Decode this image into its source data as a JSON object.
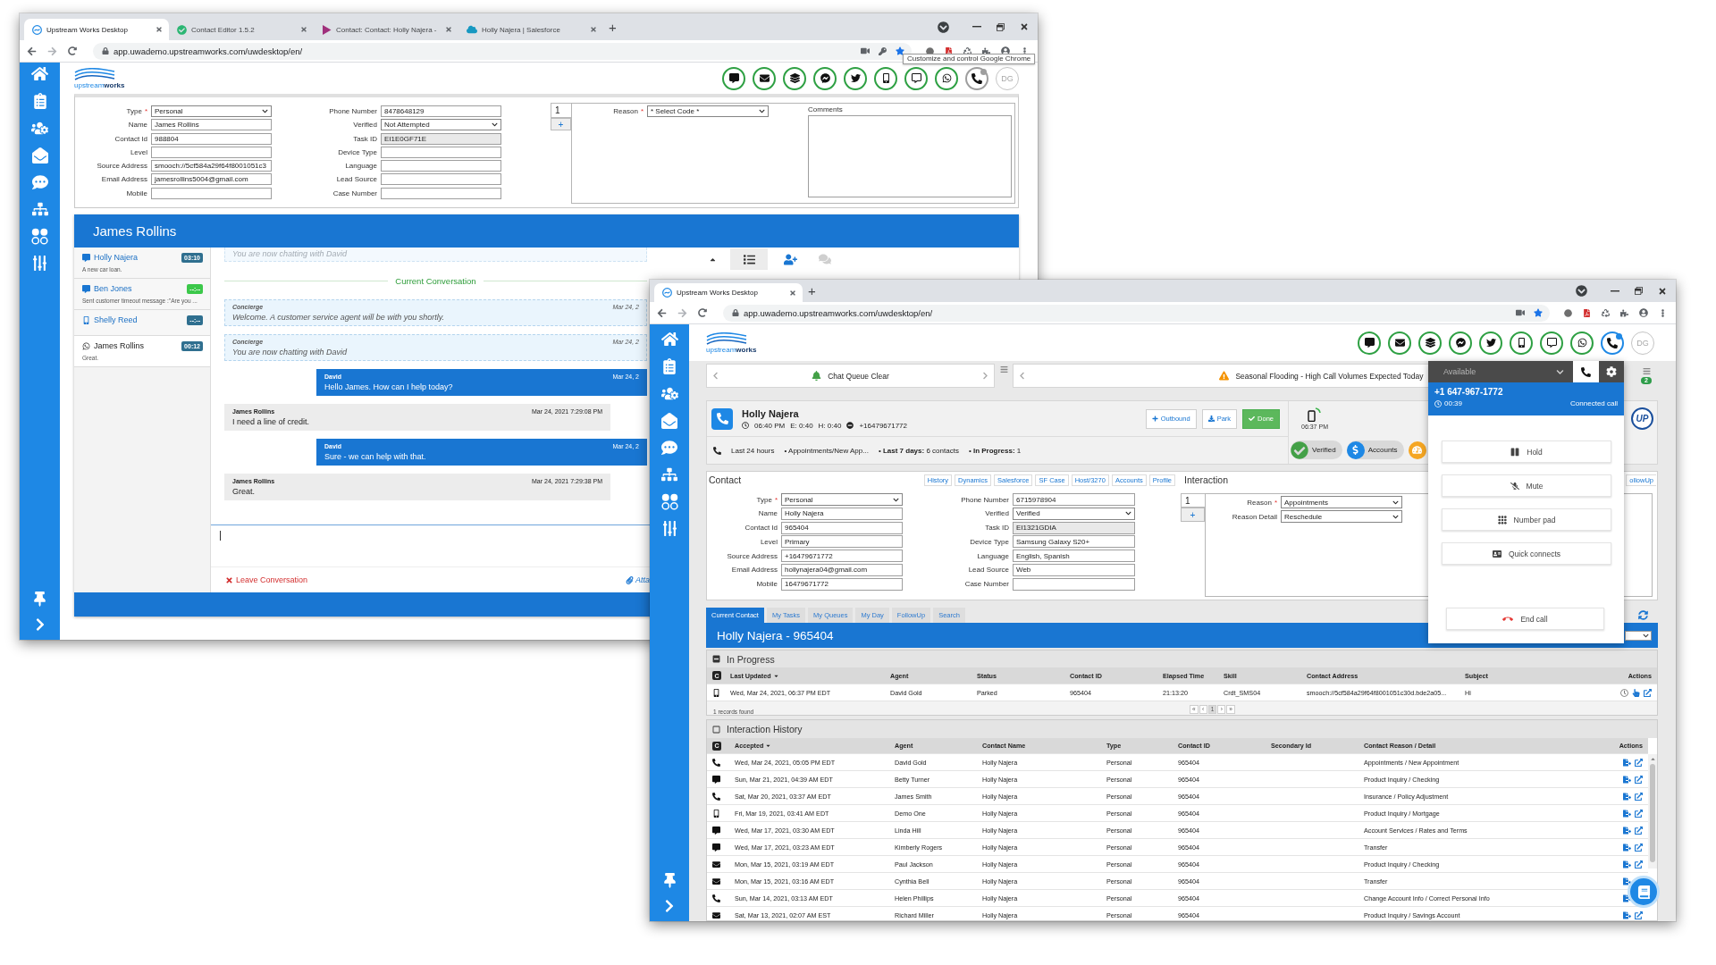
{
  "back_window": {
    "tabs": [
      {
        "title": "Upstream Works Desktop",
        "kind": "upstream",
        "selected": true
      },
      {
        "title": "Contact Editor 1.5.2",
        "kind": "editor",
        "selected": false
      },
      {
        "title": "Contact: Contact: Holly Najera -",
        "kind": "dynamics",
        "selected": false
      },
      {
        "title": "Holly Najera | Salesforce",
        "kind": "salesforce",
        "selected": false
      }
    ],
    "new_tab": "+",
    "url": "app.uwademo.upstreamworks.com/uwdesktop/en/",
    "tooltip": "Customize and control Google Chrome",
    "logo": "upstream**works**",
    "phone_channel_active": false,
    "avatar": "DG",
    "contact_left": [
      {
        "label": "Type",
        "required_mark": "*",
        "kind": "select",
        "value": "Personal",
        "disabled": false
      },
      {
        "label": "Name",
        "kind": "text",
        "value": "James Rollins",
        "disabled": false
      },
      {
        "label": "Contact Id",
        "kind": "text",
        "value": "988804",
        "disabled": false
      },
      {
        "label": "Level",
        "kind": "text",
        "disabled": false
      },
      {
        "label": "Source Address",
        "kind": "text",
        "value": "smooch://5cf584a29f64f8001051c3",
        "disabled": false
      },
      {
        "label": "Email Address",
        "kind": "text",
        "value": "jamesrollins5004@gmail.com",
        "disabled": false
      },
      {
        "label": "Mobile",
        "kind": "text",
        "disabled": false
      }
    ],
    "contact_middle": [
      {
        "label": "Phone Number",
        "kind": "text",
        "value": "8478648129",
        "disabled": false
      },
      {
        "label": "Verified",
        "kind": "select",
        "value": "Not Attempted",
        "disabled": false
      },
      {
        "label": "Task ID",
        "kind": "text",
        "value": "EI1E0GF71E",
        "disabled": true
      },
      {
        "label": "Device Type",
        "kind": "text",
        "disabled": false
      },
      {
        "label": "Language",
        "kind": "text",
        "disabled": false
      },
      {
        "label": "Lead Source",
        "kind": "text",
        "disabled": false
      },
      {
        "label": "Case Number",
        "kind": "text",
        "disabled": false
      }
    ],
    "interaction": {
      "tab": "1",
      "add": "+",
      "fields": [
        {
          "label": "Reason",
          "required_mark": "*",
          "kind": "select",
          "value": "* Select Code *",
          "disabled": false
        }
      ],
      "comments_label": "Comments"
    },
    "chat": {
      "title": "James Rollins",
      "conversations": [
        {
          "name": "Holly Najera",
          "preview": "A new car loan.",
          "timer": "03:10",
          "color": "#2f6f8f",
          "kind": "chat",
          "selected": false
        },
        {
          "name": "Ben Jones",
          "preview": "Sent customer timeout message :\"Are you ...",
          "timer": "--:--",
          "color": "#3cc84a",
          "kind": "chat",
          "selected": false
        },
        {
          "name": "Shelly Reed",
          "timer": "--:--",
          "color": "#2f6f8f",
          "kind": "mobile",
          "selected": false
        },
        {
          "name": "James Rollins",
          "preview": "Great.",
          "timer": "00:12",
          "color": "#2f6f8f",
          "kind": "whatsapp",
          "selected": true
        }
      ],
      "scrolled_message": "You are now chatting with David",
      "divider": "Current Conversation",
      "messages": [
        {
          "kind": "system",
          "sender": "Concierge",
          "text": "Welcome. A customer service agent will be with you shortly.",
          "time": "Mar 24, 2"
        },
        {
          "kind": "system",
          "sender": "Concierge",
          "text": "You are now chatting with David",
          "time": "Mar 24, 2"
        },
        {
          "kind": "agent",
          "sender": "David",
          "text": "Hello James. How can I help today?",
          "time": "Mar 24, 2"
        },
        {
          "kind": "customer",
          "sender": "James Rollins",
          "text": "I need a line of credit.",
          "time": "Mar 24, 2021 7:29:08 PM"
        },
        {
          "kind": "agent",
          "sender": "David",
          "text": "Sure - we can help with that.",
          "time": "Mar 24, 2"
        },
        {
          "kind": "customer",
          "sender": "James Rollins",
          "text": "Great.",
          "time": "Mar 24, 2021 7:29:38 PM"
        }
      ],
      "leave": "Leave Conversation",
      "attach": "Atta"
    }
  },
  "front_window": {
    "tabs": [
      {
        "title": "Upstream Works Desktop",
        "kind": "upstream",
        "selected": true
      }
    ],
    "new_tab": "+",
    "url": "app.uwademo.upstreamworks.com/uwdesktop/en/",
    "logo": "upstream**works**",
    "phone_channel_active": true,
    "avatar": "DG",
    "tickers": [
      {
        "text": "Chat Queue Clear",
        "kind": "info"
      },
      {
        "text": "Seasonal Flooding - High Call Volumes Expected Today",
        "kind": "warning"
      }
    ],
    "notification_count": "2",
    "contact_header": {
      "name": "Holly Najera",
      "time": "06:40 PM",
      "email_time": "E: 0:40",
      "hold_time": "H: 0:40",
      "phone": "+16479671772",
      "buttons": [
        {
          "label": "Outbound",
          "kind": "outbound"
        },
        {
          "label": "Park",
          "kind": "park"
        },
        {
          "label": "Done",
          "kind": "done"
        }
      ],
      "device_time": "06:37 PM",
      "logo_badge": "UP",
      "summary": [
        "Last 24 hours",
        "• Appointments/New App...",
        "• **Last 7 days:** 6 contacts",
        "• **In Progress:** 1"
      ],
      "pills": [
        {
          "label": "Verified",
          "kind": "verified"
        },
        {
          "label": "Accounts",
          "kind": "accounts"
        }
      ]
    },
    "contact": {
      "title": "Contact",
      "tabs": [
        "History",
        "Dynamics",
        "Salesforce",
        "SF Case",
        "Host/3270",
        "Accounts",
        "Profile"
      ],
      "left": [
        {
          "label": "Type",
          "required_mark": "*",
          "kind": "select",
          "value": "Personal",
          "disabled": false
        },
        {
          "label": "Name",
          "kind": "text",
          "value": "Holly Najera",
          "disabled": false
        },
        {
          "label": "Contact Id",
          "kind": "text",
          "value": "965404",
          "disabled": false
        },
        {
          "label": "Level",
          "kind": "text",
          "value": "Primary",
          "disabled": false
        },
        {
          "label": "Source Address",
          "kind": "text",
          "value": "+16479671772",
          "disabled": false
        },
        {
          "label": "Email Address",
          "kind": "text",
          "value": "hollynajera04@gmail.com",
          "disabled": false
        },
        {
          "label": "Mobile",
          "kind": "text",
          "value": "16479671772",
          "disabled": false
        }
      ],
      "middle": [
        {
          "label": "Phone Number",
          "kind": "text",
          "value": "6715978904",
          "disabled": false
        },
        {
          "label": "Verified",
          "kind": "select",
          "value": "Verified",
          "disabled": false
        },
        {
          "label": "Task ID",
          "kind": "text",
          "value": "EI1321GDIA",
          "disabled": true
        },
        {
          "label": "Device Type",
          "kind": "text",
          "value": "Samsung Galaxy S20+",
          "disabled": false
        },
        {
          "label": "Language",
          "kind": "text",
          "value": "English, Spanish",
          "disabled": false
        },
        {
          "label": "Lead Source",
          "kind": "text",
          "value": "Web",
          "disabled": false
        },
        {
          "label": "Case Number",
          "kind": "text",
          "disabled": false
        }
      ]
    },
    "interaction": {
      "title": "Interaction",
      "followup": "ollowUp",
      "tab": "1",
      "add": "+",
      "fields": [
        {
          "label": "Reason",
          "required_mark": "*",
          "kind": "select",
          "value": "Appointments",
          "disabled": false
        },
        {
          "label": "Reason Detail",
          "kind": "select",
          "value": "Reschedule",
          "disabled": false
        }
      ]
    },
    "work_tabs": [
      {
        "label": "Current Contact",
        "selected": true
      },
      {
        "label": "My Tasks",
        "selected": false
      },
      {
        "label": "My Queues",
        "selected": false
      },
      {
        "label": "My Day",
        "selected": false
      },
      {
        "label": "FollowUp",
        "selected": false
      },
      {
        "label": "Search",
        "selected": false
      }
    ],
    "title_bar": "Holly Najera - 965404",
    "in_progress": {
      "title": "In Progress",
      "expanded": true,
      "channel_header": "C",
      "columns": [
        {
          "label": "Last Updated",
          "sorted": true
        },
        {
          "label": "Agent",
          "sorted": false
        },
        {
          "label": "Status",
          "sorted": false
        },
        {
          "label": "Contact ID",
          "sorted": false
        },
        {
          "label": "Elapsed Time",
          "sorted": false
        },
        {
          "label": "Skill",
          "sorted": false
        },
        {
          "label": "Contact Address",
          "sorted": false
        },
        {
          "label": "Subject",
          "sorted": false
        },
        {
          "label": "Actions",
          "sorted": false
        }
      ],
      "rows": [
        {
          "kind": "mobile",
          "last_updated": "Wed, Mar 24, 2021, 06:37 PM EDT",
          "agent": "David Gold",
          "status": "Parked",
          "contact_id": "965404",
          "elapsed_time": "21:13:20",
          "skill": "Crdt_SMS04",
          "contact_address": "smooch://5cf584a29f64f8001051c30d.bde2a05...",
          "subject": "Hi"
        }
      ],
      "records": "1 records found",
      "pager": [
        {
          "label": "«",
          "selected": false
        },
        {
          "label": "‹",
          "selected": false
        },
        {
          "label": "1",
          "selected": true
        },
        {
          "label": "›",
          "selected": false
        },
        {
          "label": "»",
          "selected": false
        }
      ]
    },
    "history": {
      "title": "Interaction History",
      "checked": false,
      "channel_header": "C",
      "columns": [
        {
          "label": "Accepted",
          "sorted": true
        },
        {
          "label": "Agent",
          "sorted": false
        },
        {
          "label": "Contact Name",
          "sorted": false
        },
        {
          "label": "Type",
          "sorted": false
        },
        {
          "label": "Contact ID",
          "sorted": false
        },
        {
          "label": "Secondary Id",
          "sorted": false
        },
        {
          "label": "Contact Reason / Detail",
          "sorted": false
        },
        {
          "label": "Actions",
          "sorted": false
        }
      ],
      "rows": [
        {
          "kind": "phone",
          "accepted": "Wed, Mar 24, 2021, 05:05 PM EDT",
          "agent": "David Gold",
          "contact_name": "Holly Najera",
          "type": "Personal",
          "contact_id": "965404",
          "reason": "Appointments / New Appointment"
        },
        {
          "kind": "chat",
          "accepted": "Sun, Mar 21, 2021, 04:39 AM EDT",
          "agent": "Betty Turner",
          "contact_name": "Holly Najera",
          "type": "Personal",
          "contact_id": "965404",
          "reason": "Product Inquiry / Checking"
        },
        {
          "kind": "phone",
          "accepted": "Sat, Mar 20, 2021, 03:37 AM EDT",
          "agent": "James Smith",
          "contact_name": "Holly Najera",
          "type": "Personal",
          "contact_id": "965404",
          "reason": "Insurance / Policy Adjustment"
        },
        {
          "kind": "mobile",
          "accepted": "Fri, Mar 19, 2021, 03:41 AM EDT",
          "agent": "Demo One",
          "contact_name": "Holly Najera",
          "type": "Personal",
          "contact_id": "965404",
          "reason": "Product Inquiry / Mortgage"
        },
        {
          "kind": "chat",
          "accepted": "Wed, Mar 17, 2021, 03:30 AM EDT",
          "agent": "Linda Hill",
          "contact_name": "Holly Najera",
          "type": "Personal",
          "contact_id": "965404",
          "reason": "Account Services / Rates and Terms"
        },
        {
          "kind": "chat",
          "accepted": "Wed, Mar 17, 2021, 03:23 AM EDT",
          "agent": "Kimberly Rogers",
          "contact_name": "Holly Najera",
          "type": "Personal",
          "contact_id": "965404",
          "reason": "Transfer"
        },
        {
          "kind": "email",
          "accepted": "Mon, Mar 15, 2021, 03:19 AM EDT",
          "agent": "Paul Jackson",
          "contact_name": "Holly Najera",
          "type": "Personal",
          "contact_id": "965404",
          "reason": "Product Inquiry / Checking"
        },
        {
          "kind": "email",
          "accepted": "Mon, Mar 15, 2021, 03:16 AM EDT",
          "agent": "Cynthia Bell",
          "contact_name": "Holly Najera",
          "type": "Personal",
          "contact_id": "965404",
          "reason": "Transfer"
        },
        {
          "kind": "phone",
          "accepted": "Sun, Mar 14, 2021, 03:13 AM EDT",
          "agent": "Helen Phillips",
          "contact_name": "Holly Najera",
          "type": "Personal",
          "contact_id": "965404",
          "reason": "Change Account Info / Correct Personal Info"
        },
        {
          "kind": "email",
          "accepted": "Sat, Mar 13, 2021, 02:07 AM EST",
          "agent": "Richard Miller",
          "contact_name": "Holly Najera",
          "type": "Personal",
          "contact_id": "965404",
          "reason": "Product Inquiry / Savings Account"
        }
      ]
    },
    "phone_panel": {
      "status": "Available",
      "number": "+1 647-967-1772",
      "timer": "00:39",
      "state": "Connected call",
      "buttons": [
        {
          "label": "Hold",
          "kind": "hold"
        },
        {
          "label": "Mute",
          "kind": "mute"
        },
        {
          "label": "Number pad",
          "kind": "keypad"
        },
        {
          "label": "Quick connects",
          "kind": "quick_connects"
        },
        {
          "label": "End call",
          "kind": "end_call"
        }
      ]
    }
  }
}
